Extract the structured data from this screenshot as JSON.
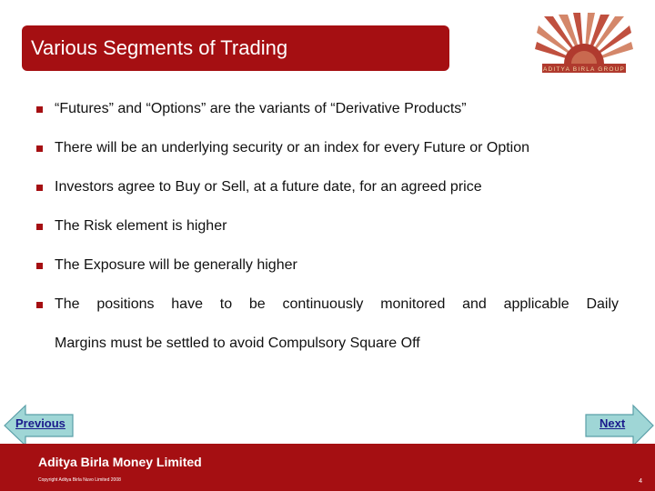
{
  "slide": {
    "title": "Various Segments of Trading",
    "bullets": [
      "“Futures” and “Options” are the variants of “Derivative Products”",
      "There will be an underlying security or an index for every Future or Option",
      "Investors agree to Buy or Sell, at a future date, for an agreed price",
      "The Risk element is higher",
      "The Exposure will be generally higher",
      "The positions have to be continuously monitored and applicable Daily"
    ],
    "bullet_continuation": "Margins must be settled to avoid Compulsory Square Off"
  },
  "logo": {
    "icon": "aditya-birla-sun-logo-icon",
    "text": "ADITYA BIRLA GROUP",
    "colors": {
      "background": "#b03a2e",
      "rays": "#f1d9a8"
    }
  },
  "navigation": {
    "previous_label": "Previous",
    "next_label": "Next",
    "arrow_fill": "#9fd6d6"
  },
  "footer": {
    "company": "Aditya Birla Money Limited",
    "copyright": "Copyright Aditya Birla Nuvo Limited 2008",
    "page_number": "4"
  },
  "colors": {
    "brand_red": "#a50f12",
    "text": "#111111",
    "link": "#1a1a8c"
  }
}
